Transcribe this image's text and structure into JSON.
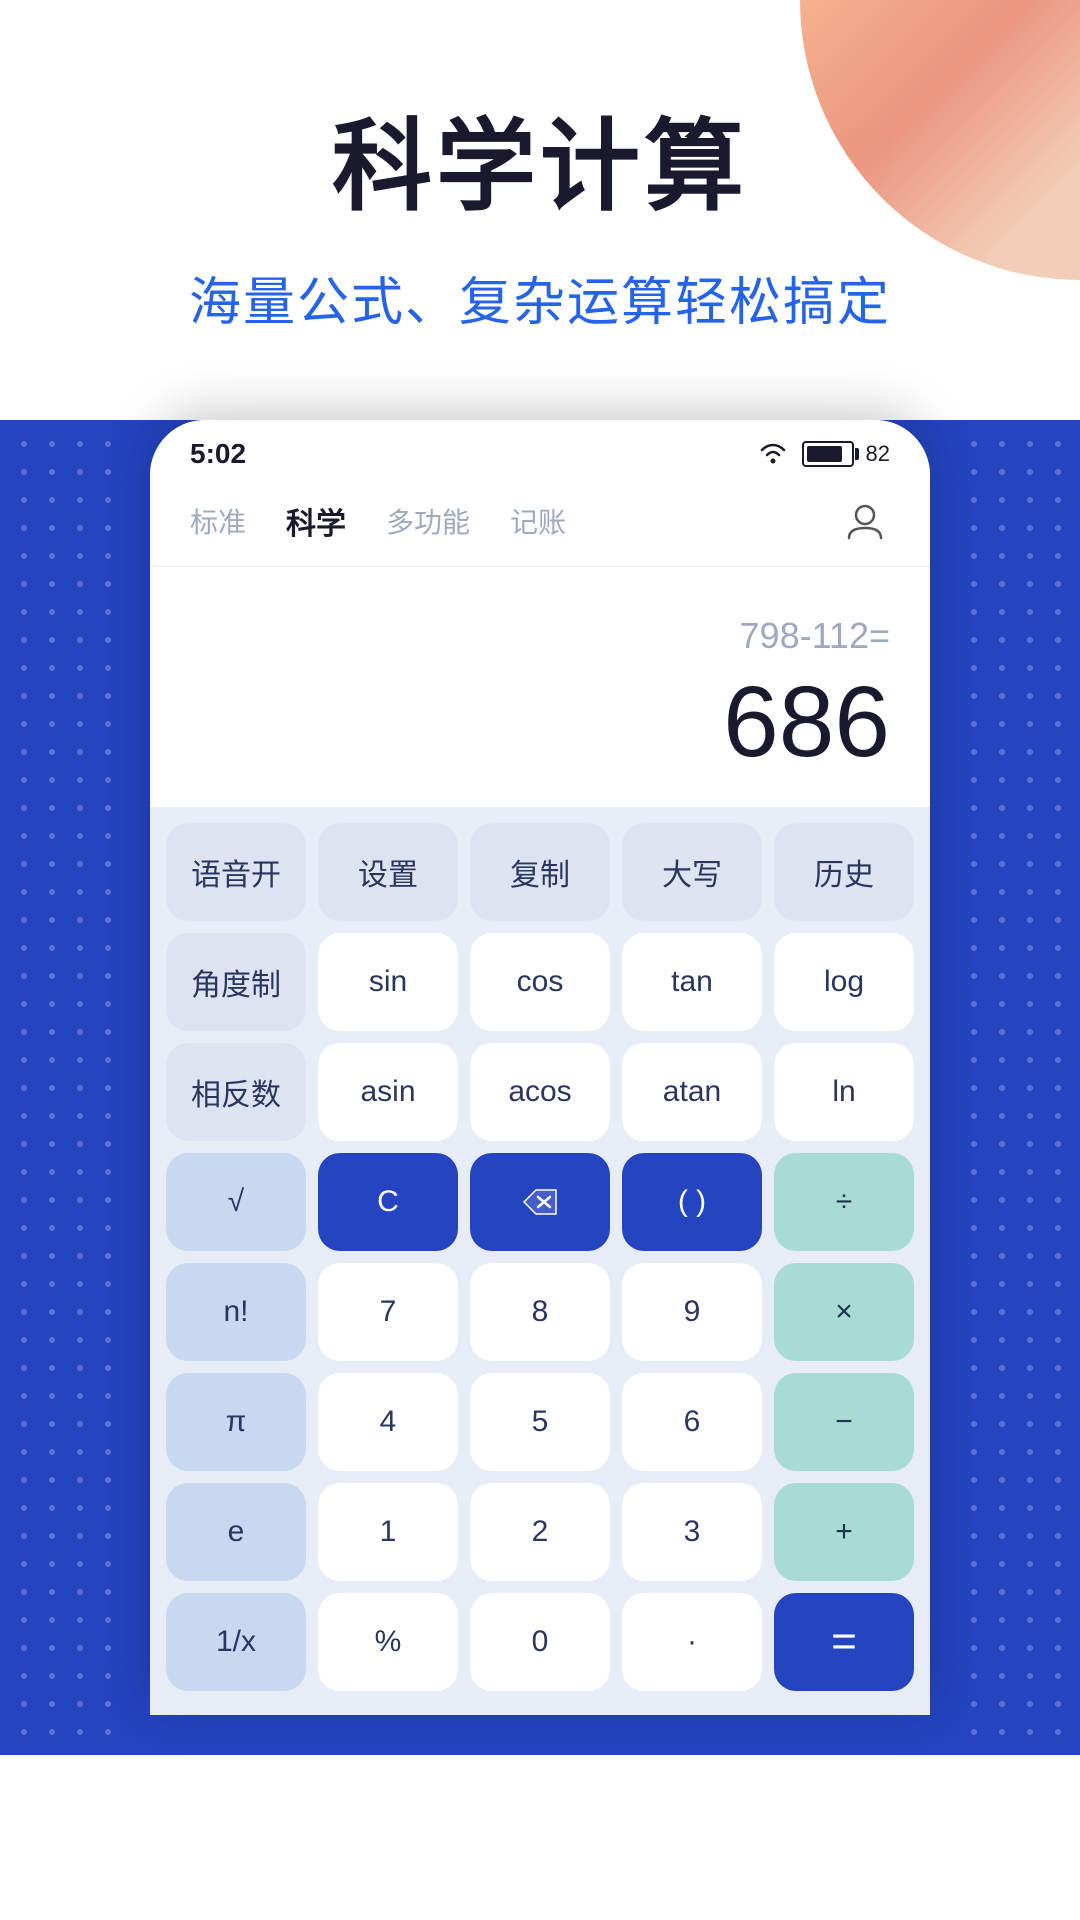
{
  "header": {
    "main_title": "科学计算",
    "subtitle": "海量公式、复杂运算轻松搞定"
  },
  "status_bar": {
    "time": "5:02",
    "battery": "82"
  },
  "nav_tabs": {
    "tabs": [
      {
        "label": "标准",
        "active": false
      },
      {
        "label": "科学",
        "active": true
      },
      {
        "label": "多功能",
        "active": false
      },
      {
        "label": "记账",
        "active": false
      }
    ]
  },
  "calculator": {
    "expression": "798-112=",
    "result": "686",
    "rows": [
      [
        {
          "label": "语音开",
          "type": "light-gray"
        },
        {
          "label": "设置",
          "type": "light-gray"
        },
        {
          "label": "复制",
          "type": "light-gray"
        },
        {
          "label": "大写",
          "type": "light-gray"
        },
        {
          "label": "历史",
          "type": "light-gray"
        }
      ],
      [
        {
          "label": "角度制",
          "type": "light-gray"
        },
        {
          "label": "sin",
          "type": "white"
        },
        {
          "label": "cos",
          "type": "white"
        },
        {
          "label": "tan",
          "type": "white"
        },
        {
          "label": "log",
          "type": "white"
        }
      ],
      [
        {
          "label": "相反数",
          "type": "light-gray"
        },
        {
          "label": "asin",
          "type": "white"
        },
        {
          "label": "acos",
          "type": "white"
        },
        {
          "label": "atan",
          "type": "white"
        },
        {
          "label": "ln",
          "type": "white"
        }
      ],
      [
        {
          "label": "√",
          "type": "light-blue"
        },
        {
          "label": "C",
          "type": "dark-blue"
        },
        {
          "label": "⌫",
          "type": "dark-blue"
        },
        {
          "label": "( )",
          "type": "dark-blue"
        },
        {
          "label": "÷",
          "type": "teal"
        }
      ],
      [
        {
          "label": "n!",
          "type": "light-blue"
        },
        {
          "label": "7",
          "type": "white"
        },
        {
          "label": "8",
          "type": "white"
        },
        {
          "label": "9",
          "type": "white"
        },
        {
          "label": "×",
          "type": "teal"
        }
      ],
      [
        {
          "label": "π",
          "type": "light-blue"
        },
        {
          "label": "4",
          "type": "white"
        },
        {
          "label": "5",
          "type": "white"
        },
        {
          "label": "6",
          "type": "white"
        },
        {
          "label": "−",
          "type": "teal"
        }
      ],
      [
        {
          "label": "e",
          "type": "light-blue"
        },
        {
          "label": "1",
          "type": "white"
        },
        {
          "label": "2",
          "type": "white"
        },
        {
          "label": "3",
          "type": "white"
        },
        {
          "label": "+",
          "type": "teal"
        }
      ],
      [
        {
          "label": "1/x",
          "type": "light-blue"
        },
        {
          "label": "%",
          "type": "white"
        },
        {
          "label": "0",
          "type": "white"
        },
        {
          "label": "·",
          "type": "white"
        },
        {
          "label": "=",
          "type": "equal"
        }
      ]
    ]
  }
}
